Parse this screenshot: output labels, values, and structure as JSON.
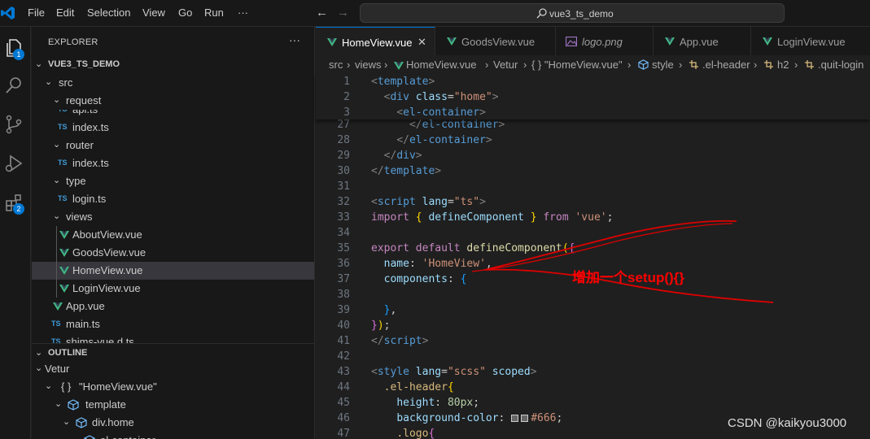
{
  "menu": [
    "File",
    "Edit",
    "Selection",
    "View",
    "Go",
    "Run",
    "···"
  ],
  "search": {
    "text": "vue3_ts_demo"
  },
  "activity": {
    "explorer_badge": "1",
    "extensions_badge": "2"
  },
  "explorer": {
    "title": "EXPLORER",
    "more": "···",
    "project": "VUE3_TS_DEMO",
    "items": [
      {
        "label": "src",
        "kind": "folder"
      },
      {
        "label": "request",
        "kind": "folder"
      },
      {
        "label": "api.ts",
        "kind": "ts"
      },
      {
        "label": "index.ts",
        "kind": "ts"
      },
      {
        "label": "router",
        "kind": "folder"
      },
      {
        "label": "index.ts",
        "kind": "ts"
      },
      {
        "label": "type",
        "kind": "folder"
      },
      {
        "label": "login.ts",
        "kind": "ts"
      },
      {
        "label": "views",
        "kind": "folder"
      },
      {
        "label": "AboutView.vue",
        "kind": "vue"
      },
      {
        "label": "GoodsView.vue",
        "kind": "vue"
      },
      {
        "label": "HomeView.vue",
        "kind": "vue",
        "selected": true
      },
      {
        "label": "LoginView.vue",
        "kind": "vue"
      },
      {
        "label": "App.vue",
        "kind": "vue"
      },
      {
        "label": "main.ts",
        "kind": "ts"
      },
      {
        "label": "shims-vue.d.ts",
        "kind": "ts"
      }
    ],
    "ts_icon_text": "TS"
  },
  "outline": {
    "title": "OUTLINE",
    "items": [
      {
        "label": "Vetur"
      },
      {
        "label": "\"HomeView.vue\"",
        "icon": "{ }"
      },
      {
        "label": "template"
      },
      {
        "label": "div.home"
      },
      {
        "label": "el-container"
      }
    ]
  },
  "tabs": [
    {
      "label": "HomeView.vue",
      "active": true,
      "close": "✕"
    },
    {
      "label": "GoodsView.vue"
    },
    {
      "label": "logo.png"
    },
    {
      "label": "App.vue"
    },
    {
      "label": "LoginView.vue"
    }
  ],
  "breadcrumb": [
    "src",
    "views",
    "HomeView.vue",
    "Vetur",
    "{ } \"HomeView.vue\"",
    "style",
    ".el-header",
    "h2",
    ".quit-login"
  ],
  "code": {
    "sticky_numbers": [
      "1",
      "2",
      "3"
    ],
    "line_numbers": [
      "27",
      "28",
      "29",
      "30",
      "31",
      "32",
      "33",
      "34",
      "35",
      "36",
      "37",
      "38",
      "39",
      "40",
      "41",
      "42",
      "43",
      "44",
      "45",
      "46",
      "47"
    ],
    "bg_color": "#666"
  },
  "annotation": {
    "text": "增加一个setup(){}",
    "color": "#ff0000"
  },
  "watermark": {
    "text": "CSDN @kaikyou3000"
  }
}
